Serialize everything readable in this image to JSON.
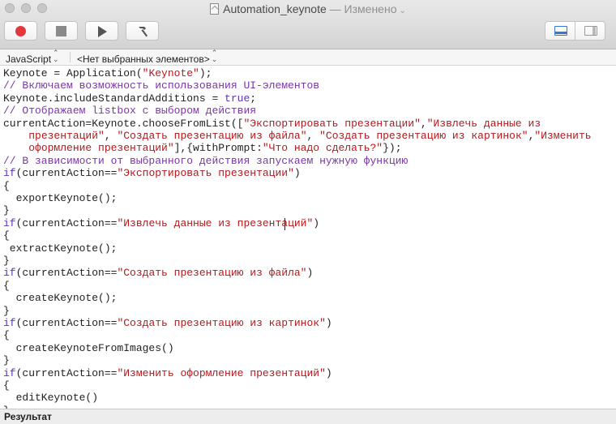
{
  "window": {
    "title": "Automation_keynote",
    "title_separator": " — ",
    "edited_status": "Изменено"
  },
  "toolbar": {
    "buttons": [
      "record",
      "stop",
      "run",
      "compile"
    ],
    "layout_buttons": [
      "show-log",
      "show-library"
    ],
    "record_color": "#e3373b",
    "accent_color": "#3576d8"
  },
  "navbar": {
    "language": "JavaScript",
    "element_selector": "<Нет выбранных элементов>"
  },
  "editor": {
    "lines": [
      [
        {
          "t": "Keynote = Application(",
          "c": "def"
        },
        {
          "t": "\"Keynote\"",
          "c": "str"
        },
        {
          "t": ");",
          "c": "def"
        }
      ],
      [
        {
          "t": "// Включаем возможность использования UI-элементов",
          "c": "comment"
        }
      ],
      [
        {
          "t": "Keynote.includeStandardAdditions = ",
          "c": "def"
        },
        {
          "t": "true",
          "c": "kw"
        },
        {
          "t": ";",
          "c": "def"
        }
      ],
      [
        {
          "t": "// Отображаем listbox с выбором действия",
          "c": "comment"
        }
      ],
      [
        {
          "t": "currentAction=Keynote.chooseFromList([",
          "c": "def"
        },
        {
          "t": "\"Экспортировать презентации\"",
          "c": "str"
        },
        {
          "t": ",",
          "c": "def"
        },
        {
          "t": "\"Извлечь данные из",
          "c": "str"
        }
      ],
      [
        {
          "t": "    ",
          "c": "def"
        },
        {
          "t": "презентаций\"",
          "c": "str"
        },
        {
          "t": ", ",
          "c": "def"
        },
        {
          "t": "\"Создать презентацию из файла\"",
          "c": "str"
        },
        {
          "t": ", ",
          "c": "def"
        },
        {
          "t": "\"Создать презентацию из картинок\"",
          "c": "str"
        },
        {
          "t": ",",
          "c": "def"
        },
        {
          "t": "\"Изменить",
          "c": "str"
        }
      ],
      [
        {
          "t": "    ",
          "c": "def"
        },
        {
          "t": "оформление презентаций\"",
          "c": "str"
        },
        {
          "t": "],{withPrompt:",
          "c": "def"
        },
        {
          "t": "\"Что надо сделать?\"",
          "c": "str"
        },
        {
          "t": "});",
          "c": "def"
        }
      ],
      [
        {
          "t": "// В зависимости от выбранного действия запускаем нужную функцию",
          "c": "comment"
        }
      ],
      [
        {
          "t": "if",
          "c": "kw"
        },
        {
          "t": "(currentAction==",
          "c": "def"
        },
        {
          "t": "\"Экспортировать презентации\"",
          "c": "str"
        },
        {
          "t": ")",
          "c": "def"
        }
      ],
      [
        {
          "t": "{",
          "c": "def"
        }
      ],
      [
        {
          "t": "  exportKeynote();",
          "c": "def"
        }
      ],
      [
        {
          "t": "}",
          "c": "def"
        }
      ],
      [
        {
          "t": "if",
          "c": "kw"
        },
        {
          "t": "(currentAction==",
          "c": "def"
        },
        {
          "t": "\"Извлечь данные из презентаций\"",
          "c": "str"
        },
        {
          "t": ")",
          "c": "def"
        }
      ],
      [
        {
          "t": "{",
          "c": "def"
        }
      ],
      [
        {
          "t": " extractKeynote();",
          "c": "def"
        }
      ],
      [
        {
          "t": "}",
          "c": "def"
        }
      ],
      [
        {
          "t": "if",
          "c": "kw"
        },
        {
          "t": "(currentAction==",
          "c": "def"
        },
        {
          "t": "\"Создать презентацию из файла\"",
          "c": "str"
        },
        {
          "t": ")",
          "c": "def"
        }
      ],
      [
        {
          "t": "{",
          "c": "def"
        }
      ],
      [
        {
          "t": "  createKeynote();",
          "c": "def"
        }
      ],
      [
        {
          "t": "}",
          "c": "def"
        }
      ],
      [
        {
          "t": "if",
          "c": "kw"
        },
        {
          "t": "(currentAction==",
          "c": "def"
        },
        {
          "t": "\"Создать презентацию из картинок\"",
          "c": "str"
        },
        {
          "t": ")",
          "c": "def"
        }
      ],
      [
        {
          "t": "{",
          "c": "def"
        }
      ],
      [
        {
          "t": "  createKeynoteFromImages()",
          "c": "def"
        }
      ],
      [
        {
          "t": "}",
          "c": "def"
        }
      ],
      [
        {
          "t": "if",
          "c": "kw"
        },
        {
          "t": "(currentAction==",
          "c": "def"
        },
        {
          "t": "\"Изменить оформление презентаций\"",
          "c": "str"
        },
        {
          "t": ")",
          "c": "def"
        }
      ],
      [
        {
          "t": "{",
          "c": "def"
        }
      ],
      [
        {
          "t": "  editKeynote()",
          "c": "def"
        }
      ],
      [
        {
          "t": "}",
          "c": "def"
        }
      ]
    ]
  },
  "result": {
    "label": "Результат"
  }
}
